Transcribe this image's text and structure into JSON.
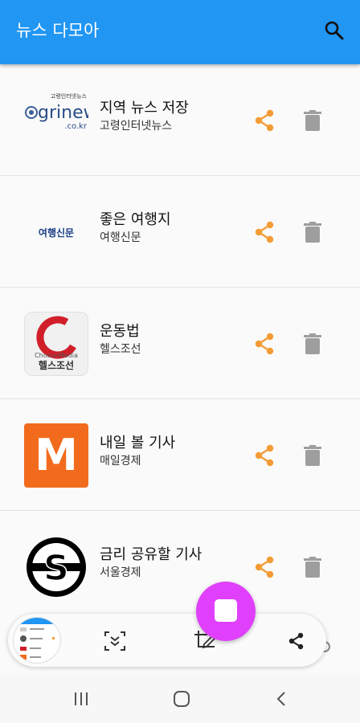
{
  "appbar": {
    "title": "뉴스 다모아",
    "search_icon": "search-icon",
    "color": "#2196f3"
  },
  "items": [
    {
      "title": "지역 뉴스 저장",
      "source": "고령인터넷뉴스",
      "logo": {
        "type": "grinews",
        "small": "고령인터넷뉴스",
        "brand": "grinews",
        "domain": ".co.kr"
      }
    },
    {
      "title": "좋은 여행지",
      "source": "여행신문",
      "logo": {
        "type": "travel",
        "text": "여행신문"
      }
    },
    {
      "title": "운동법",
      "source": "헬스조선",
      "logo": {
        "type": "health",
        "small": "ChosunMedia",
        "text": "헬스조선"
      }
    },
    {
      "title": "내일 볼 기사",
      "source": "매일경제",
      "logo": {
        "type": "mk",
        "text": "M"
      }
    },
    {
      "title": "금리 공유할 기사",
      "source": "서울경제",
      "logo": {
        "type": "sedaily",
        "text": "S"
      }
    }
  ],
  "accent_share": "#f39c35",
  "trash_color": "#9e9e9e",
  "fab_color": "#e040fb",
  "toolbar": {
    "buttons": [
      "scroll-capture-icon",
      "crop-edit-icon",
      "share-icon"
    ]
  },
  "navbar": {
    "buttons": [
      "recent-apps-icon",
      "home-icon",
      "back-icon"
    ]
  }
}
